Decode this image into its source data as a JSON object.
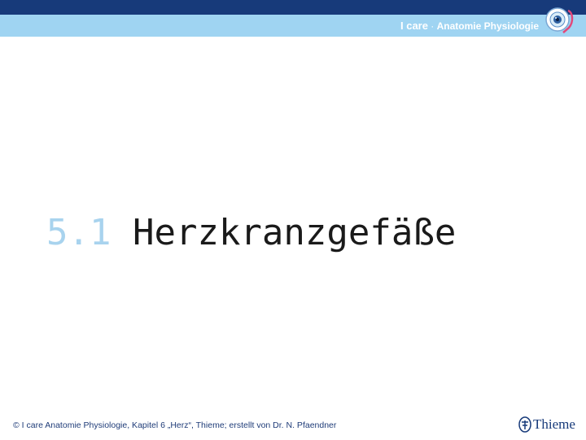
{
  "header": {
    "brand_primary": "I care",
    "brand_separator": " · ",
    "brand_secondary": "Anatomie Physiologie",
    "logo_icon": "eye-heart-badge-icon"
  },
  "slide": {
    "section_number": "5.1",
    "title": "Herzkranzgefäße"
  },
  "footer": {
    "copyright": "© I care Anatomie Physiologie, Kapitel 6 „Herz“, Thieme; erstellt von Dr. N. Pfaendner",
    "publisher": "Thieme",
    "publisher_icon": "thieme-logo-icon"
  },
  "colors": {
    "top_bar": "#173a7a",
    "sub_bar": "#9fd4f2",
    "section_number": "#a8d3ee",
    "footer_text": "#1f3c78"
  }
}
